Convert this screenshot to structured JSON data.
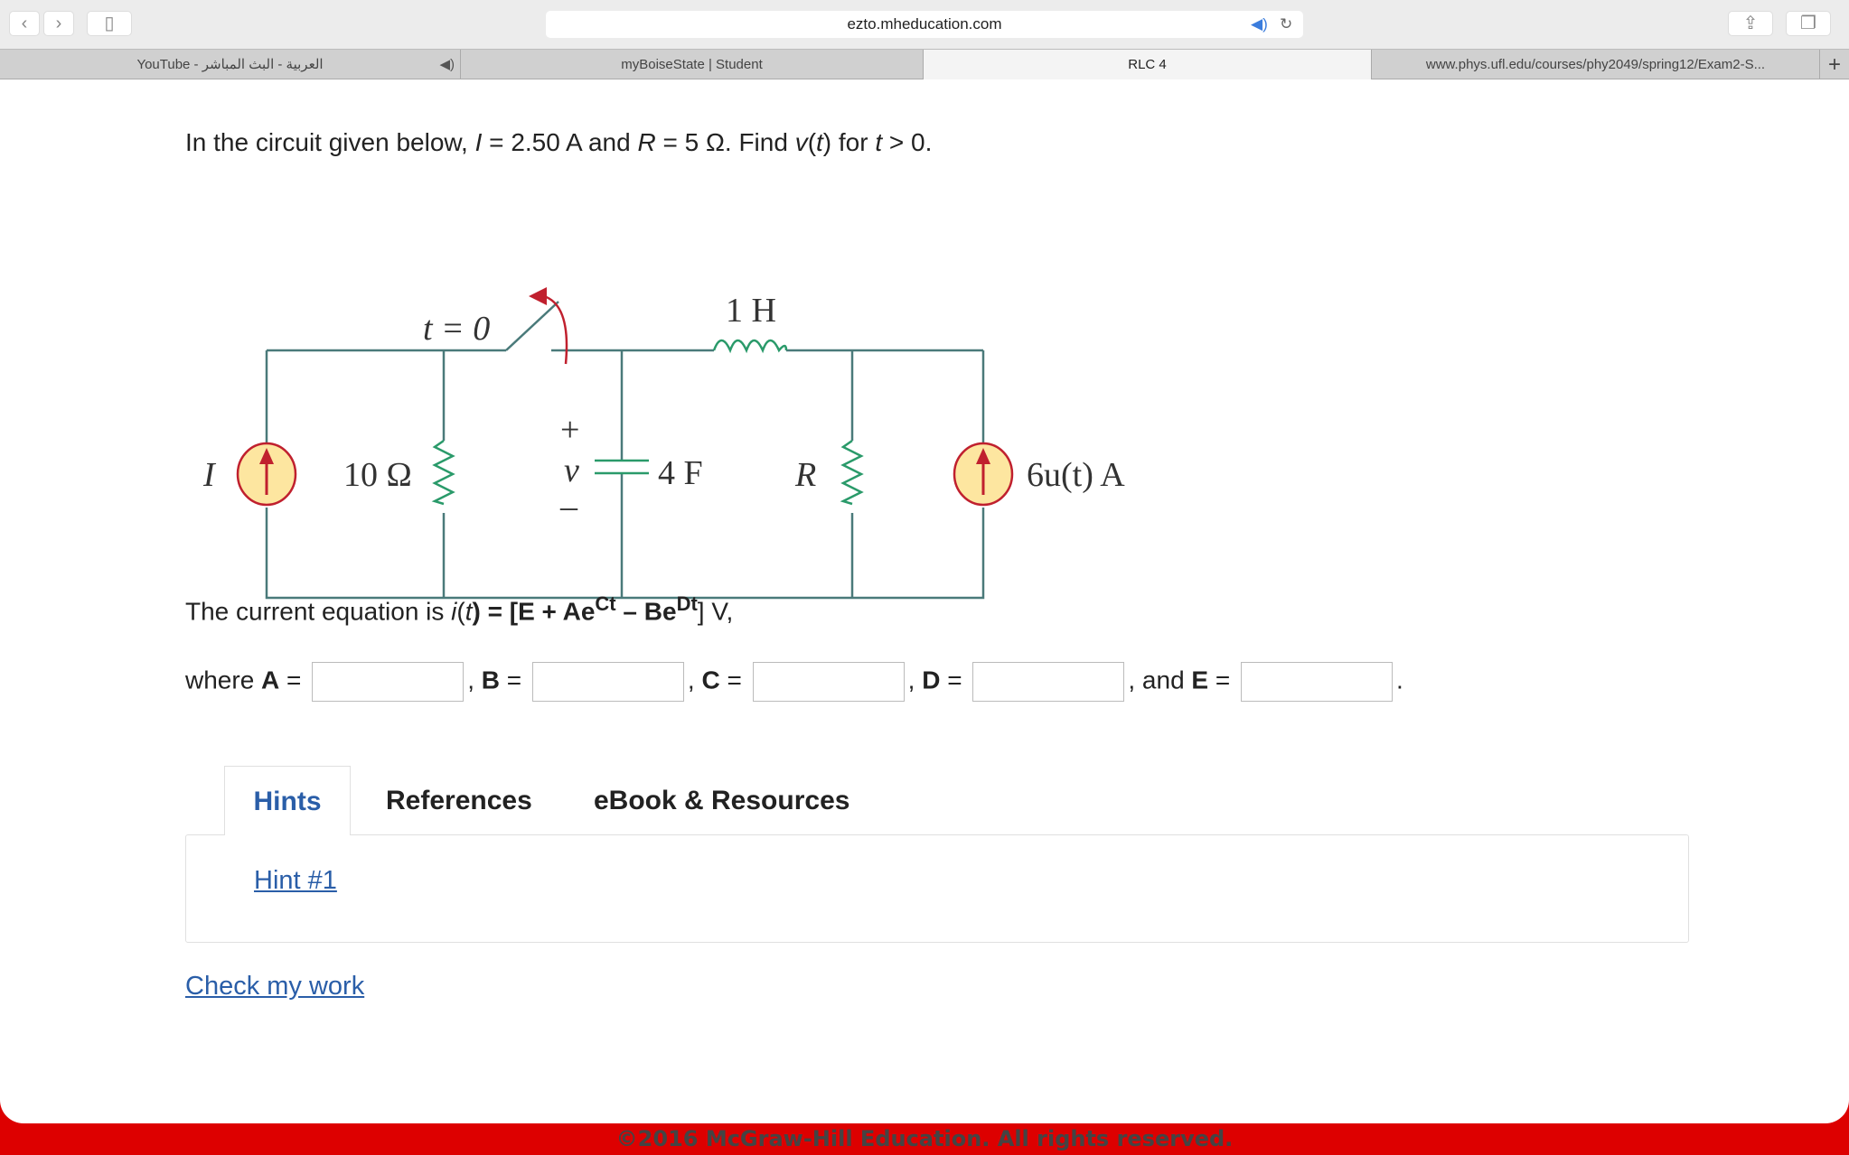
{
  "browser": {
    "url": "ezto.mheducation.com",
    "tabs": [
      {
        "label": "YouTube - العربية - البث المباشر",
        "audio": true
      },
      {
        "label": "myBoiseState | Student"
      },
      {
        "label": "RLC 4",
        "active": true
      },
      {
        "label": "www.phys.ufl.edu/courses/phy2049/spring12/Exam2-S..."
      }
    ],
    "icons": [
      "back-icon",
      "forward-icon",
      "sidebar-icon",
      "speaker-icon",
      "reload-icon",
      "share-icon",
      "tabs-icon",
      "new-tab-icon"
    ]
  },
  "question": {
    "pre": "In the circuit given below, ",
    "I": "I",
    "eq1": " = 2.50 A and ",
    "R": "R",
    "eq2": " = 5 Ω. Find ",
    "v": "v",
    "t1": "t",
    "mid": ") for ",
    "t2": "t",
    "end": " > 0."
  },
  "circuit": {
    "switch": "t = 0",
    "inductor": "1 H",
    "source_left": "I",
    "res1": "10 Ω",
    "cap": "4 F",
    "v_plus": "+",
    "v": "v",
    "v_minus": "–",
    "res2": "R",
    "source_right": "6u(t) A",
    "wire_color": "#4a7a7a",
    "component_color": "#2a9a6a",
    "arrow_color": "#c0202e",
    "source_fill": "#fde6a0"
  },
  "equation": {
    "pre": "The current equation is ",
    "i": "i",
    "t": "t",
    "body": ") = [E + Ae",
    "C": "Ct",
    "minus": " – Be",
    "D": "Dt",
    "post": "] V,"
  },
  "answers": {
    "where": "where ",
    "A": "A",
    "B": "B",
    "C": "C",
    "D": "D",
    "E": "E",
    "eq": " = ",
    "sep": ", ",
    "and": ", and ",
    "dot": ".",
    "values": {
      "A": "",
      "B": "",
      "C": "",
      "D": "",
      "E": ""
    }
  },
  "resource_tabs": [
    {
      "label": "Hints",
      "active": true
    },
    {
      "label": "References"
    },
    {
      "label": "eBook & Resources"
    }
  ],
  "hint_link": "Hint #1",
  "check_link": "Check my work",
  "footer": "©2016 McGraw-Hill Education. All rights reserved.",
  "colors": {
    "accent": "#2a5ea8",
    "footer": "#dd0000"
  }
}
